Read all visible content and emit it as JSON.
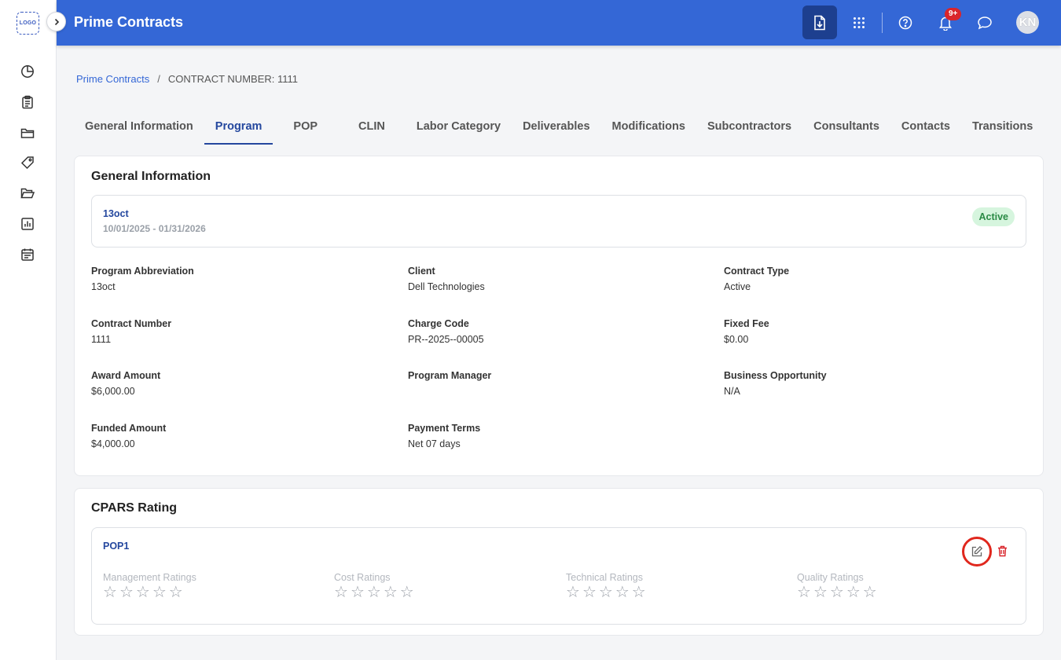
{
  "app": {
    "logo_text": "LOGO",
    "title": "Prime Contracts"
  },
  "header": {
    "notification_count": "9+",
    "avatar_initials": "KN"
  },
  "breadcrumb": {
    "parent": "Prime Contracts",
    "separator": "/",
    "current": "CONTRACT NUMBER: 1111"
  },
  "tabs": [
    {
      "label": "General Information"
    },
    {
      "label": "Program"
    },
    {
      "label": "POP"
    },
    {
      "label": "CLIN"
    },
    {
      "label": "Labor Category"
    },
    {
      "label": "Deliverables"
    },
    {
      "label": "Modifications"
    },
    {
      "label": "Subcontractors"
    },
    {
      "label": "Consultants"
    },
    {
      "label": "Contacts"
    },
    {
      "label": "Transitions"
    }
  ],
  "active_tab": "Program",
  "general": {
    "title": "General Information",
    "program_name": "13oct",
    "program_dates": "10/01/2025 - 01/31/2026",
    "status": "Active",
    "fields": {
      "program_abbreviation": {
        "label": "Program Abbreviation",
        "value": "13oct"
      },
      "client": {
        "label": "Client",
        "value": "Dell Technologies"
      },
      "contract_type": {
        "label": "Contract Type",
        "value": "Active"
      },
      "contract_number": {
        "label": "Contract Number",
        "value": "1111"
      },
      "charge_code": {
        "label": "Charge Code",
        "value": "PR--2025--00005"
      },
      "fixed_fee": {
        "label": "Fixed Fee",
        "value": "$0.00"
      },
      "award_amount": {
        "label": "Award Amount",
        "value": "$6,000.00"
      },
      "program_manager": {
        "label": "Program Manager",
        "value": ""
      },
      "business_opportunity": {
        "label": "Business Opportunity",
        "value": "N/A"
      },
      "funded_amount": {
        "label": "Funded Amount",
        "value": "$4,000.00"
      },
      "payment_terms": {
        "label": "Payment Terms",
        "value": "Net 07 days"
      }
    }
  },
  "cpars": {
    "title": "CPARS Rating",
    "pop_name": "POP1",
    "ratings": {
      "management": {
        "label": "Management Ratings",
        "stars": 0,
        "max": 5
      },
      "cost": {
        "label": "Cost Ratings",
        "stars": 0,
        "max": 5
      },
      "technical": {
        "label": "Technical Ratings",
        "stars": 0,
        "max": 5
      },
      "quality": {
        "label": "Quality Ratings",
        "stars": 0,
        "max": 5
      }
    }
  },
  "colors": {
    "header": "#3467d6",
    "accent": "#24479e",
    "active_badge_bg": "#d6f5de",
    "delete": "#d9252b",
    "highlight_ring": "#e0271d"
  },
  "icons": {
    "sidebar": [
      "pie-chart-icon",
      "clipboard-icon",
      "folder-icon",
      "tag-icon",
      "folder-open-icon",
      "bar-chart-icon",
      "calendar-icon"
    ],
    "header": [
      "download-document-icon",
      "apps-grid-icon",
      "help-icon",
      "bell-icon",
      "chat-icon"
    ]
  }
}
